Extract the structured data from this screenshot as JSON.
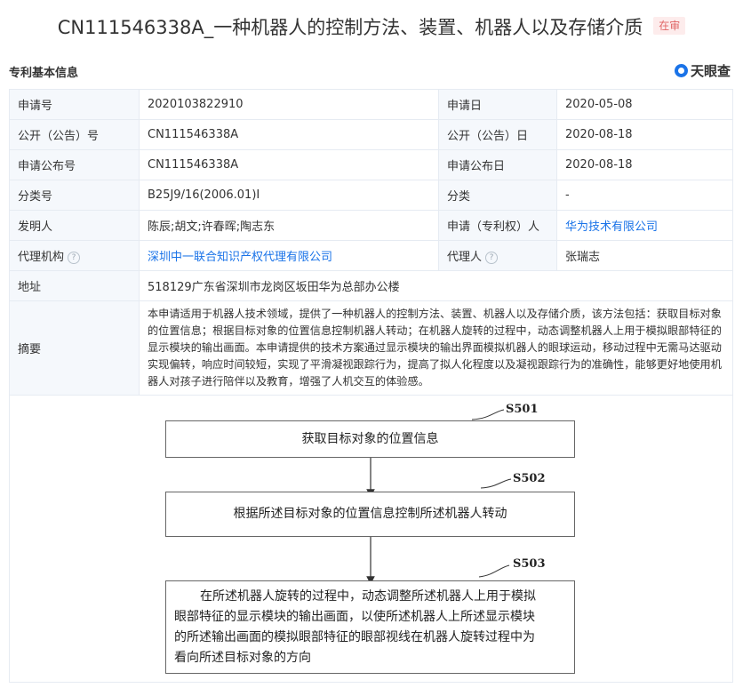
{
  "header": {
    "title": "CN111546338A_一种机器人的控制方法、装置、机器人以及存储介质",
    "status": "在审"
  },
  "section": {
    "title": "专利基本信息",
    "brand": "天眼查",
    "brand_icon": "tianyancha-logo-icon"
  },
  "rows": {
    "app_no": {
      "label": "申请号",
      "value": "2020103822910"
    },
    "app_date": {
      "label": "申请日",
      "value": "2020-05-08"
    },
    "pub_no": {
      "label": "公开（公告）号",
      "value": "CN111546338A"
    },
    "pub_date": {
      "label": "公开（公告）日",
      "value": "2020-08-18"
    },
    "app_pub_no": {
      "label": "申请公布号",
      "value": "CN111546338A"
    },
    "app_pub_date": {
      "label": "申请公布日",
      "value": "2020-08-18"
    },
    "class_no": {
      "label": "分类号",
      "value": "B25J9/16(2006.01)I"
    },
    "category": {
      "label": "分类",
      "value": "-"
    },
    "inventor": {
      "label": "发明人",
      "value": "陈辰;胡文;许春晖;陶志东"
    },
    "applicant": {
      "label": "申请（专利权）人",
      "value": "华为技术有限公司"
    },
    "agency": {
      "label": "代理机构",
      "value": "深圳中一联合知识产权代理有限公司"
    },
    "agent": {
      "label": "代理人",
      "value": "张瑞志"
    },
    "address": {
      "label": "地址",
      "value": "518129广东省深圳市龙岗区坂田华为总部办公楼"
    },
    "abstract": {
      "label": "摘要",
      "value": "本申请适用于机器人技术领域，提供了一种机器人的控制方法、装置、机器人以及存储介质，该方法包括：获取目标对象的位置信息；根据目标对象的位置信息控制机器人转动；在机器人旋转的过程中，动态调整机器人上用于模拟眼部特征的显示模块的输出画面。本申请提供的技术方案通过显示模块的输出界面模拟机器人的眼球运动，移动过程中无需马达驱动实现偏转，响应时间较短，实现了平滑凝视跟踪行为，提高了拟人化程度以及凝视跟踪行为的准确性，能够更好地使用机器人对孩子进行陪伴以及教育，增强了人机交互的体验感。"
    }
  },
  "help_icon": "?",
  "flowchart": {
    "steps": [
      {
        "id": "S501",
        "text": "获取目标对象的位置信息"
      },
      {
        "id": "S502",
        "text": "根据所述目标对象的位置信息控制所述机器人转动"
      },
      {
        "id": "S503",
        "lines": [
          "在所述机器人旋转的过程中，动态调整所述机器人上用于模拟",
          "眼部特征的显示模块的输出画面，以使所述机器人上所述显示模块",
          "的所述输出画面的模拟眼部特征的眼部视线在机器人旋转过程中为",
          "看向所述目标对象的方向"
        ]
      }
    ]
  }
}
